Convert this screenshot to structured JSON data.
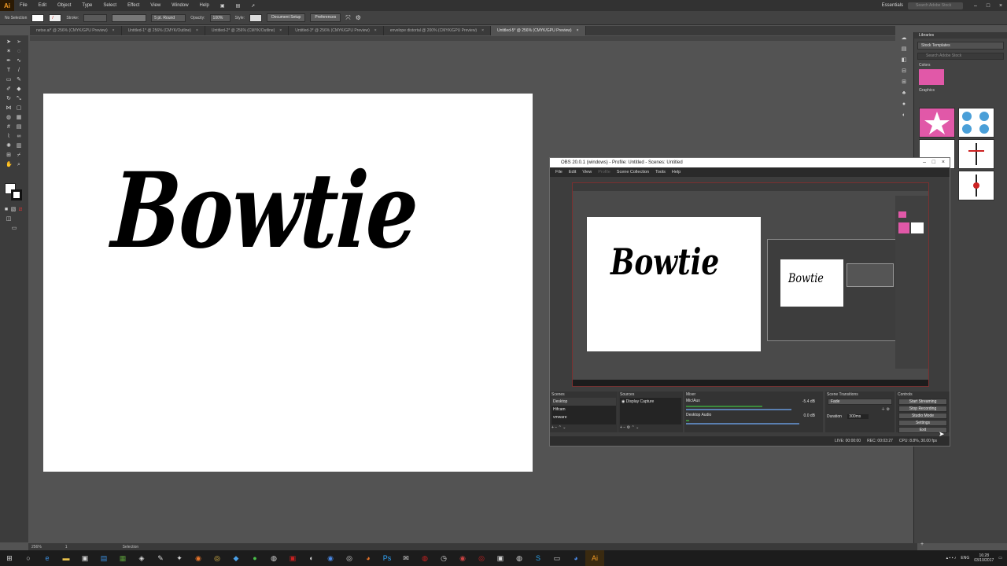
{
  "illustrator": {
    "logo": "Ai",
    "menu": [
      "File",
      "Edit",
      "Object",
      "Type",
      "Select",
      "Effect",
      "View",
      "Window",
      "Help"
    ],
    "workspace": "Essentials",
    "search_placeholder": "Search Adobe Stock",
    "control": {
      "selection": "No Selection",
      "stroke_label": "Stroke:",
      "brush": "5 pt. Round",
      "opacity_label": "Opacity:",
      "opacity_value": "100%",
      "style_label": "Style:",
      "doc_setup": "Document Setup",
      "preferences": "Preferences"
    },
    "tabs": [
      {
        "label": "netse.ai* @ 256% (CMYK/GPU Preview)",
        "active": false
      },
      {
        "label": "Untitled-1* @ 256% (CMYK/Outline)",
        "active": false
      },
      {
        "label": "Untitled-2* @ 256% (CMYK/Outline)",
        "active": false
      },
      {
        "label": "Untitled-3* @ 256% (CMYK/GPU Preview)",
        "active": false
      },
      {
        "label": "envelope distortal @ 200% (CMYK/GPU Preview)",
        "active": false
      },
      {
        "label": "Untitled-5* @ 256% (CMYK/GPU Preview)",
        "active": true
      }
    ],
    "artboard_text": "Bowtie",
    "status": {
      "zoom": "256%",
      "page": "1",
      "mode": "Selection"
    },
    "libraries": {
      "title": "Libraries",
      "library": "Stock Templates",
      "search_placeholder": "Search Adobe Stock",
      "colors_label": "Colors",
      "graphics_label": "Graphics",
      "swatch_color": "#e158a8"
    }
  },
  "obs": {
    "title": "OBS 20.0.1 (windows) - Profile: Untitled - Scenes: Untitled",
    "menu": [
      "File",
      "Edit",
      "View",
      "Profile",
      "Scene Collection",
      "Tools",
      "Help"
    ],
    "preview_text": "Bowtie",
    "scenes": {
      "title": "Scenes",
      "items": [
        "Desktop",
        "Hifcam",
        "vmware"
      ]
    },
    "sources": {
      "title": "Sources",
      "items": [
        "Display Capture"
      ]
    },
    "mixer": {
      "title": "Mixer",
      "channels": [
        {
          "name": "Mic/Aux",
          "level": "-5.4 dB",
          "fill": 0.55
        },
        {
          "name": "Desktop Audio",
          "level": "0.0 dB",
          "fill": 0.02
        }
      ]
    },
    "transitions": {
      "title": "Scene Transitions",
      "value": "Fade",
      "duration_label": "Duration",
      "duration": "300ms"
    },
    "controls": {
      "title": "Controls",
      "buttons": [
        "Start Streaming",
        "Stop Recording",
        "Studio Mode",
        "Settings",
        "Exit"
      ]
    },
    "status": {
      "live": "LIVE: 00:00:00",
      "rec": "REC: 00:03:27",
      "cpu": "CPU: 8.8%, 30.00 fps"
    }
  },
  "taskbar": {
    "lang": "ENG",
    "time": "16:28",
    "date": "03/10/2017"
  }
}
